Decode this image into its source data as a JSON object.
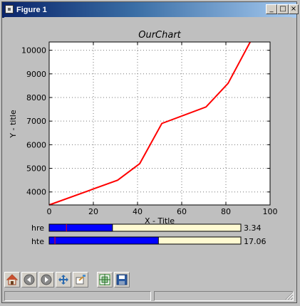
{
  "window": {
    "title": "Figure 1",
    "minimize_label": "_",
    "maximize_label": "□",
    "close_label": "×"
  },
  "sliders": [
    {
      "label": "hre",
      "value_text": "3.34",
      "fraction": 0.33,
      "marker_fraction": 0.09
    },
    {
      "label": "hte",
      "value_text": "17.06",
      "fraction": 0.57,
      "marker_fraction": 0.03
    }
  ],
  "toolbar": {
    "buttons": [
      "home-icon",
      "back-icon",
      "forward-icon",
      "pan-icon",
      "zoom-icon",
      "subplots-icon",
      "save-icon"
    ]
  },
  "chart_data": {
    "type": "line",
    "title": "OurChart",
    "xlabel": "X - Title",
    "ylabel": "Y - title",
    "xlim": [
      0,
      100
    ],
    "ylim": [
      3450,
      10350
    ],
    "x_ticks": [
      0,
      20,
      40,
      60,
      80,
      100
    ],
    "y_ticks": [
      4000,
      5000,
      6000,
      7000,
      8000,
      9000,
      10000
    ],
    "grid": true,
    "series": [
      {
        "color": "#ff0000",
        "x": [
          0,
          31,
          41,
          51,
          71,
          81,
          91
        ],
        "y": [
          3450,
          4500,
          5200,
          6900,
          7600,
          8600,
          10350
        ]
      }
    ]
  }
}
